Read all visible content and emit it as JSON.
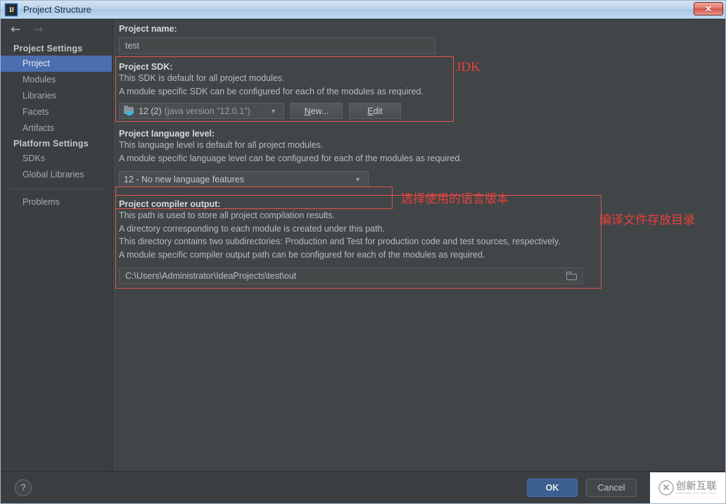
{
  "window": {
    "title": "Project Structure",
    "app_icon": "intellij-idea-icon",
    "close_label": "✕"
  },
  "nav": {
    "back_icon": "arrow-left-icon",
    "forward_icon": "arrow-right-icon",
    "back_glyph": "←",
    "forward_glyph": "→"
  },
  "sidebar": {
    "groups": [
      {
        "label": "Project Settings",
        "items": [
          {
            "label": "Project",
            "selected": true
          },
          {
            "label": "Modules",
            "selected": false
          },
          {
            "label": "Libraries",
            "selected": false
          },
          {
            "label": "Facets",
            "selected": false
          },
          {
            "label": "Artifacts",
            "selected": false
          }
        ]
      },
      {
        "label": "Platform Settings",
        "items": [
          {
            "label": "SDKs",
            "selected": false
          },
          {
            "label": "Global Libraries",
            "selected": false
          }
        ]
      }
    ],
    "problems_label": "Problems"
  },
  "main": {
    "project_name": {
      "label": "Project name:",
      "value": "test",
      "placeholder": ""
    },
    "project_sdk": {
      "label": "Project SDK:",
      "desc_line1": "This SDK is default for all project modules.",
      "desc_line2": "A module specific SDK can be configured for each of the modules as required.",
      "selected": "12 (2)",
      "selected_detail": "(java version \"12.0.1\")",
      "sdk_icon": "java-sdk-folder-icon",
      "caret_icon": "chevron-down-icon",
      "new_button": "New...",
      "new_button_mnemonic": "N",
      "edit_button": "Edit",
      "edit_button_mnemonic": "E"
    },
    "language_level": {
      "label": "Project language level:",
      "desc_line1": "This language level is default for all project modules.",
      "desc_line2": "A module specific language level can be configured for each of the modules as required.",
      "selected": "12 - No new language features",
      "caret_icon": "chevron-down-icon"
    },
    "compiler_output": {
      "label": "Project compiler output:",
      "desc_line1": "This path is used to store all project compilation results.",
      "desc_line2": "A directory corresponding to each module is created under this path.",
      "desc_line3": "This directory contains two subdirectories: Production and Test for production code and test sources, respectively.",
      "desc_line4": "A module specific compiler output path can be configured for each of the modules as required.",
      "value": "C:\\Users\\Administrator\\IdeaProjects\\test\\out",
      "browse_icon": "folder-browse-icon"
    }
  },
  "annotations": {
    "color": "#e8403a",
    "sdk_note": "JDK",
    "language_note": "选择使用的语言版本",
    "output_note": "编译文件存放目录"
  },
  "bottom": {
    "help_label": "?",
    "help_icon": "question-mark-icon",
    "ok_label": "OK",
    "cancel_label": "Cancel"
  },
  "watermark": {
    "logo_glyph": "✕",
    "logo_icon": "circle-x-logo-icon",
    "name_cn": "创新互联",
    "name_en": "CHUANG XIN HU LIAN"
  },
  "theme": {
    "accent": "#4b6eaf",
    "sidebar_bg": "#3c3f41",
    "main_bg": "#414548",
    "annotation_red": "#e8403a"
  }
}
